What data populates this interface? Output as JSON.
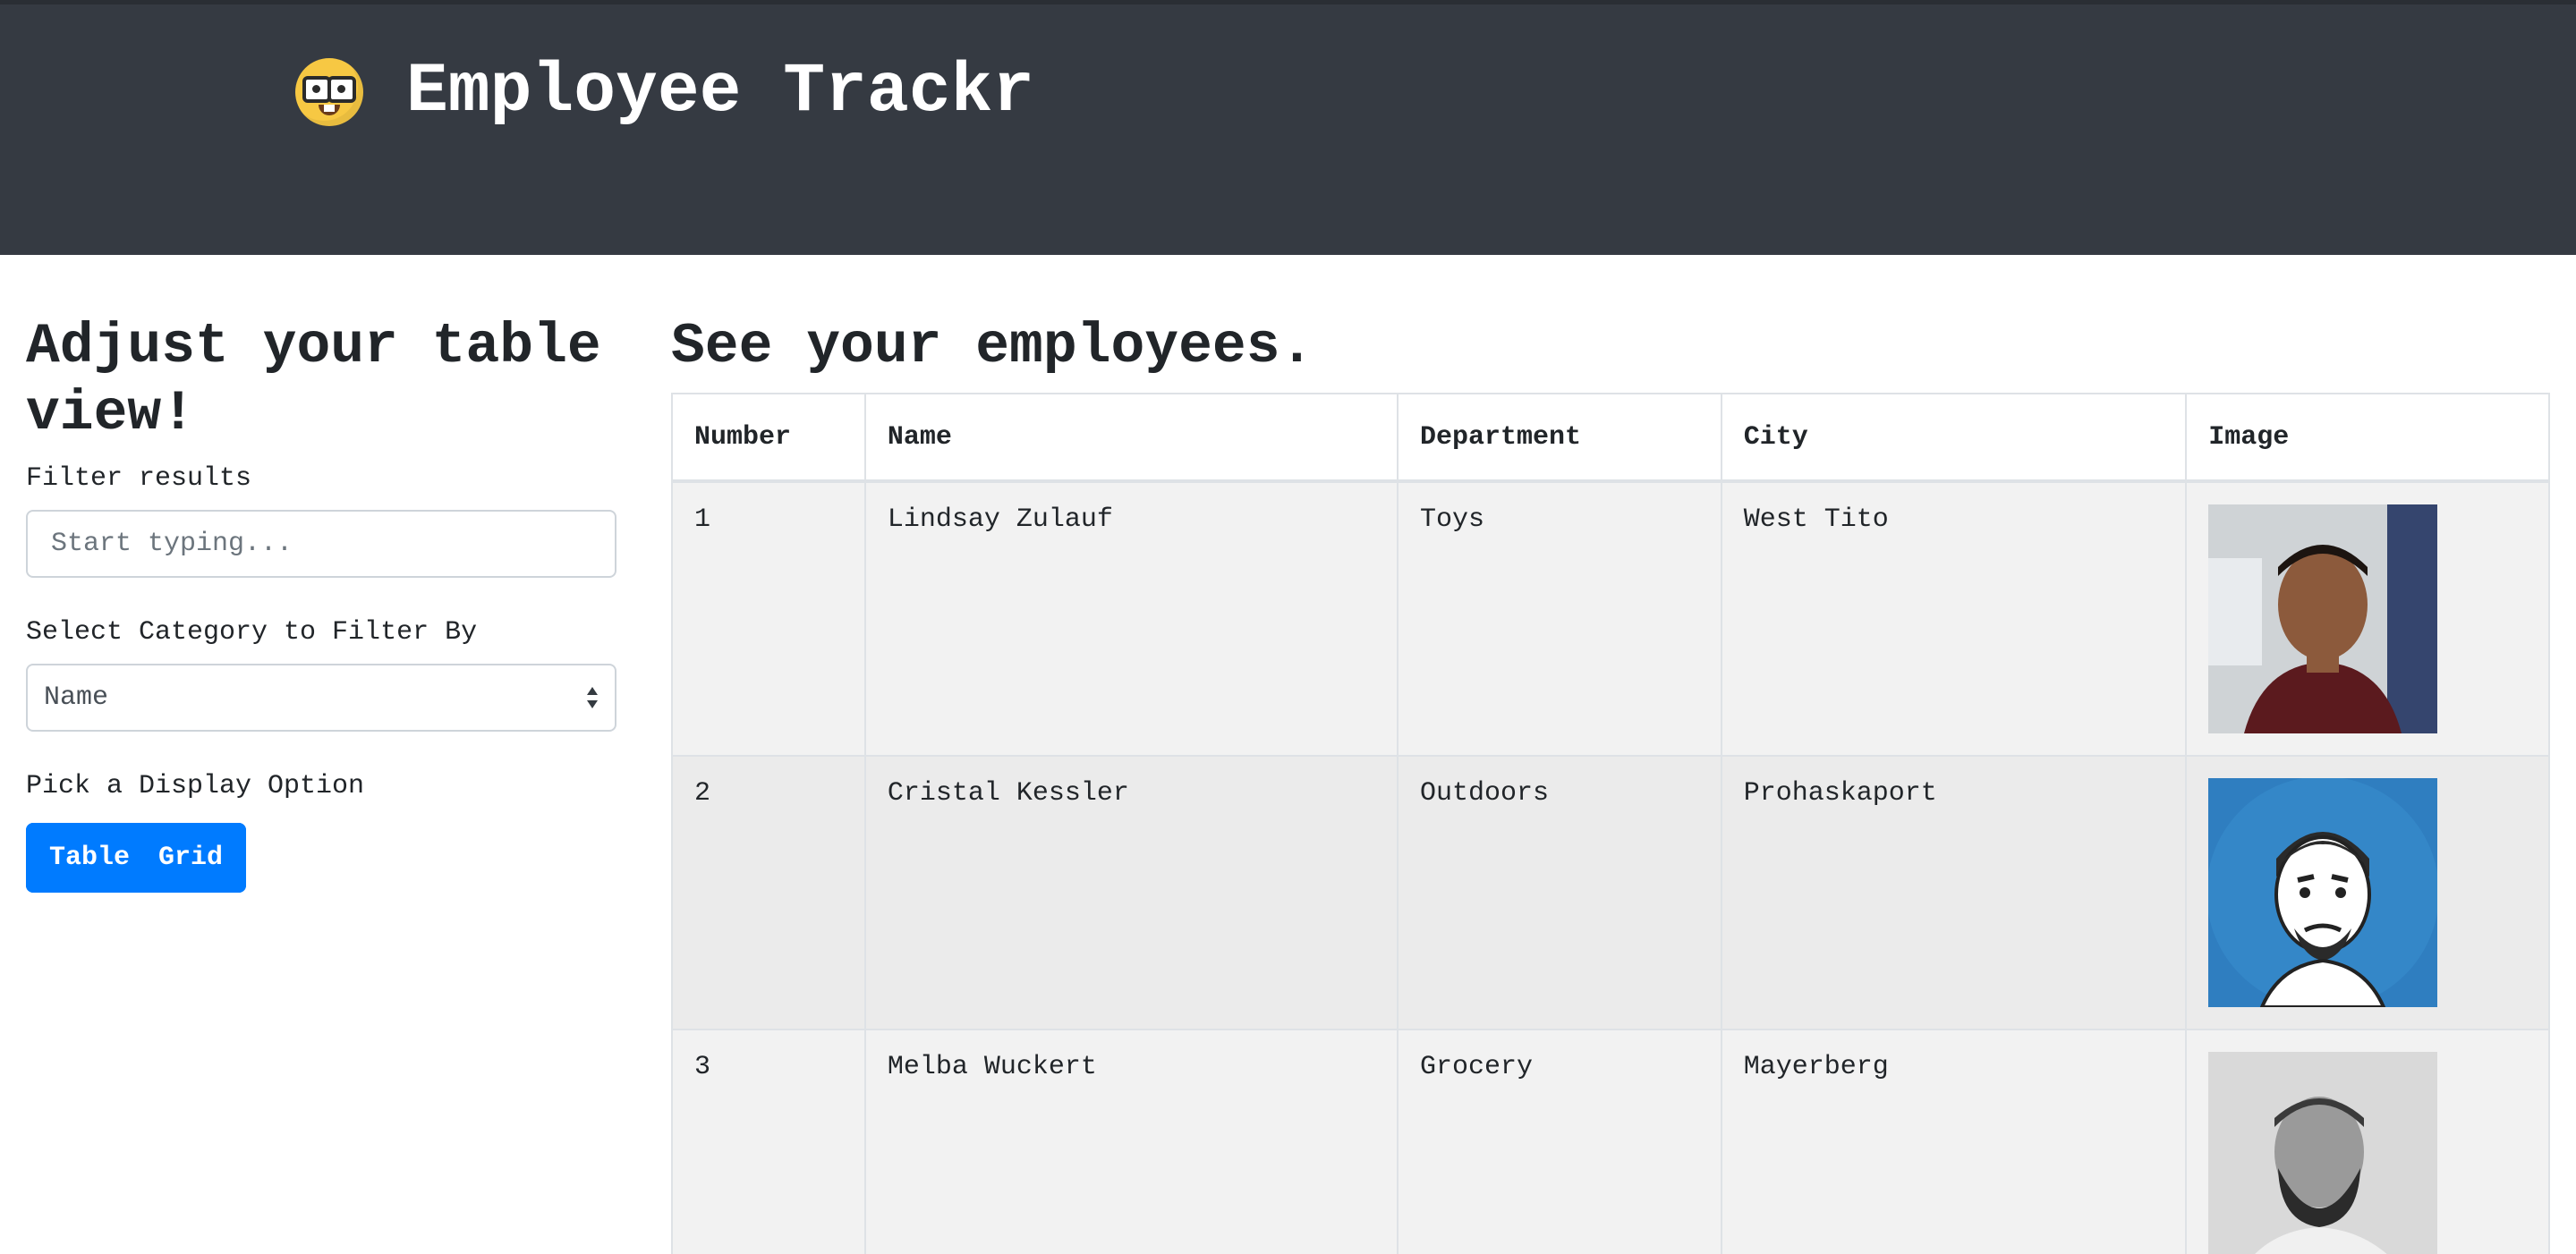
{
  "header": {
    "emoji_icon": "nerd-face-emoji",
    "title": "Employee Trackr",
    "background": "#353a42"
  },
  "sidebar": {
    "heading": "Adjust your table view!",
    "filter_label": "Filter results",
    "filter_placeholder": "Start typing...",
    "filter_value": "",
    "category_label": "Select Category to Filter By",
    "category_selected": "Name",
    "display_label": "Pick a Display Option",
    "display_options": [
      "Table",
      "Grid"
    ],
    "accent": "#007bff"
  },
  "main": {
    "heading": "See your employees.",
    "columns": [
      "Number",
      "Name",
      "Department",
      "City",
      "Image"
    ],
    "rows": [
      {
        "number": "1",
        "name": "Lindsay Zulauf",
        "department": "Toys",
        "city": "West Tito",
        "image": "man-photo-portrait"
      },
      {
        "number": "2",
        "name": "Cristal Kessler",
        "department": "Outdoors",
        "city": "Prohaskaport",
        "image": "cartoon-bearded-man-avatar"
      },
      {
        "number": "3",
        "name": "Melba Wuckert",
        "department": "Grocery",
        "city": "Mayerberg",
        "image": "bearded-man-bw-photo"
      }
    ]
  }
}
